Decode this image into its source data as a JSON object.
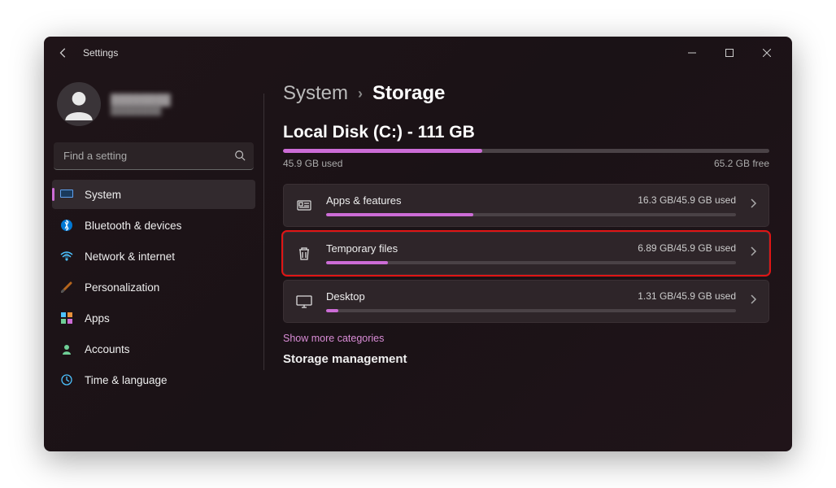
{
  "app_title": "Settings",
  "profile": {
    "name": "████████",
    "email": "████████"
  },
  "search": {
    "placeholder": "Find a setting"
  },
  "sidebar": {
    "items": [
      {
        "label": "System",
        "active": true
      },
      {
        "label": "Bluetooth & devices"
      },
      {
        "label": "Network & internet"
      },
      {
        "label": "Personalization"
      },
      {
        "label": "Apps"
      },
      {
        "label": "Accounts"
      },
      {
        "label": "Time & language"
      }
    ]
  },
  "breadcrumb": {
    "parent": "System",
    "current": "Storage"
  },
  "disk": {
    "title": "Local Disk (C:) - 111 GB",
    "used_label": "45.9 GB used",
    "free_label": "65.2 GB free",
    "used_pct": 41
  },
  "categories": [
    {
      "name": "Apps & features",
      "size": "16.3 GB/45.9 GB used",
      "pct": 36,
      "highlight": false,
      "icon": "apps"
    },
    {
      "name": "Temporary files",
      "size": "6.89 GB/45.9 GB used",
      "pct": 15,
      "highlight": true,
      "icon": "trash"
    },
    {
      "name": "Desktop",
      "size": "1.31 GB/45.9 GB used",
      "pct": 3,
      "highlight": false,
      "icon": "desktop"
    }
  ],
  "show_more": "Show more categories",
  "section_heading": "Storage management",
  "icon_colors": {
    "system": "#5ea0ef",
    "bt": "#0078d4",
    "net": "#4cc2ff",
    "pers": "#e8913a",
    "apps": "#4cc2ff",
    "acct": "#6fcf97",
    "time": "#4cc2ff"
  }
}
